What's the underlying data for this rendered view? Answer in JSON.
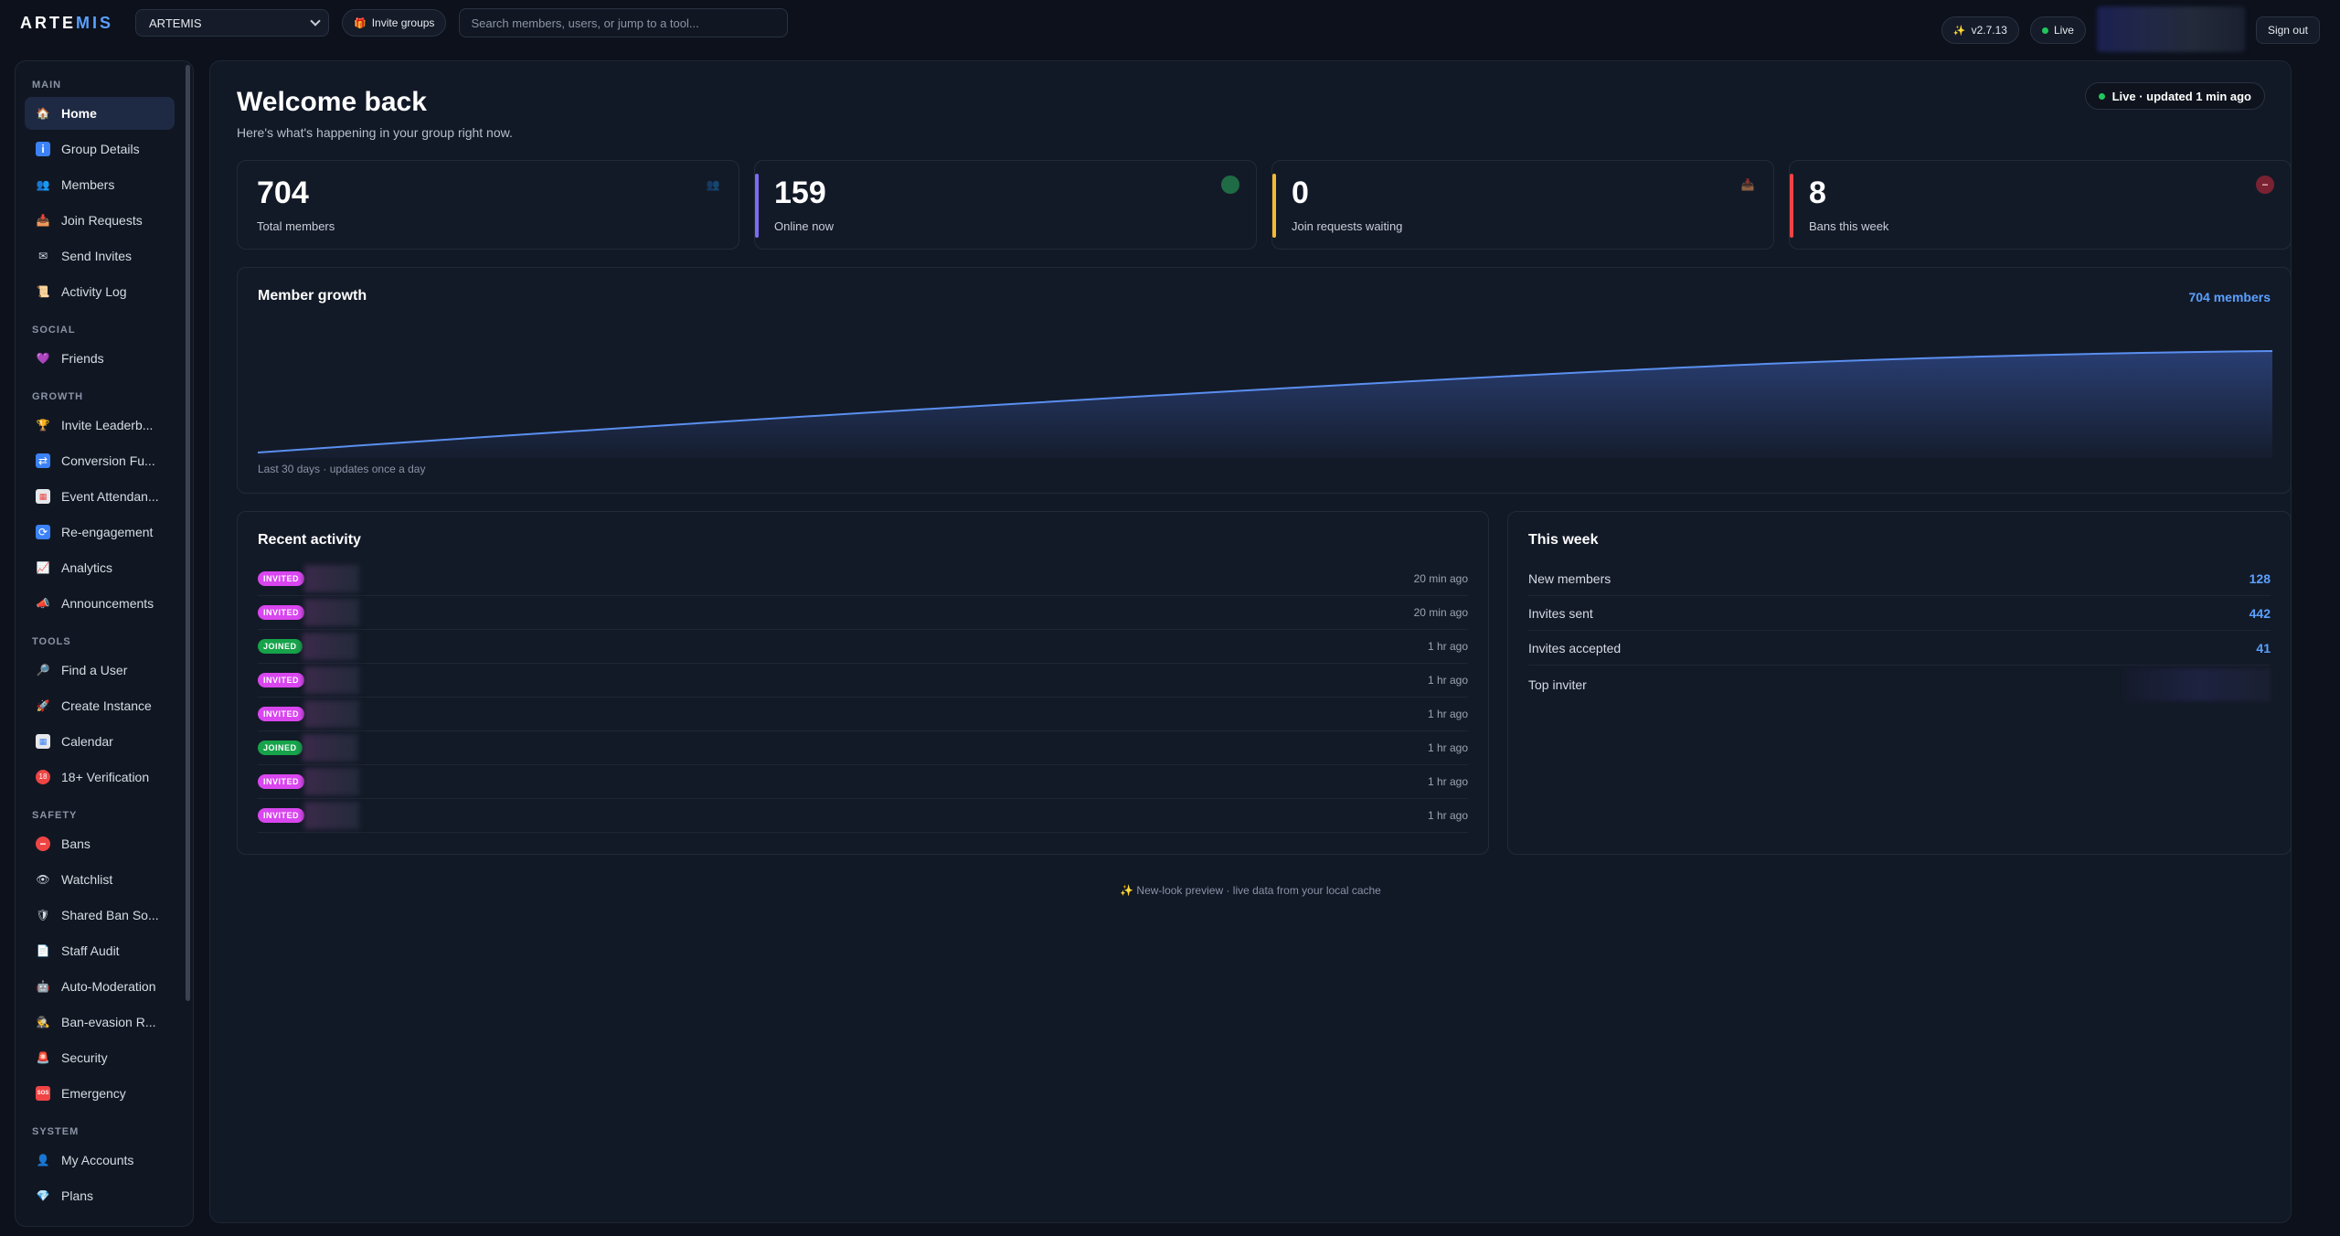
{
  "topbar": {
    "logo_main": "ARTE",
    "logo_accent": "MIS",
    "group_select_value": "ARTEMIS",
    "invite_groups_label": "Invite groups",
    "search_placeholder": "Search members, users, or jump to a tool...",
    "version_label": "v2.7.13",
    "live_label": "Live",
    "sign_out_label": "Sign out"
  },
  "sidebar": {
    "sections": {
      "main": "MAIN",
      "social": "SOCIAL",
      "growth": "GROWTH",
      "tools": "TOOLS",
      "safety": "SAFETY",
      "system": "SYSTEM"
    },
    "items": {
      "home": "Home",
      "group_details": "Group Details",
      "members": "Members",
      "join_requests": "Join Requests",
      "send_invites": "Send Invites",
      "activity_log": "Activity Log",
      "friends": "Friends",
      "invite_leaderboard": "Invite Leaderb...",
      "conversion_funnel": "Conversion Fu...",
      "event_attendance": "Event Attendan...",
      "reengagement": "Re-engagement",
      "analytics": "Analytics",
      "announcements": "Announcements",
      "find_user": "Find a User",
      "create_instance": "Create Instance",
      "calendar": "Calendar",
      "verification": "18+ Verification",
      "bans": "Bans",
      "watchlist": "Watchlist",
      "shared_ban": "Shared Ban So...",
      "staff_audit": "Staff Audit",
      "auto_moderation": "Auto-Moderation",
      "ban_evasion": "Ban-evasion R...",
      "security": "Security",
      "emergency": "Emergency",
      "my_accounts": "My Accounts",
      "plans": "Plans"
    }
  },
  "main": {
    "title": "Welcome back",
    "subtitle": "Here's what's happening in your group right now.",
    "live_status": "Live · updated 1 min ago",
    "stats": {
      "total_members": {
        "value": "704",
        "label": "Total members"
      },
      "online_now": {
        "value": "159",
        "label": "Online now"
      },
      "join_requests": {
        "value": "0",
        "label": "Join requests waiting"
      },
      "bans_week": {
        "value": "8",
        "label": "Bans this week"
      }
    },
    "growth": {
      "title": "Member growth",
      "count_label": "704 members",
      "caption": "Last 30 days · updates once a day"
    },
    "activity": {
      "title": "Recent activity",
      "rows": [
        {
          "badge": "INVITED",
          "time": "20 min ago"
        },
        {
          "badge": "INVITED",
          "time": "20 min ago"
        },
        {
          "badge": "JOINED",
          "time": "1 hr ago"
        },
        {
          "badge": "INVITED",
          "time": "1 hr ago"
        },
        {
          "badge": "INVITED",
          "time": "1 hr ago"
        },
        {
          "badge": "JOINED",
          "time": "1 hr ago"
        },
        {
          "badge": "INVITED",
          "time": "1 hr ago"
        },
        {
          "badge": "INVITED",
          "time": "1 hr ago"
        }
      ]
    },
    "week": {
      "title": "This week",
      "new_members": {
        "label": "New members",
        "value": "128"
      },
      "invites_sent": {
        "label": "Invites sent",
        "value": "442"
      },
      "invites_accepted": {
        "label": "Invites accepted",
        "value": "41"
      },
      "top_inviter": {
        "label": "Top inviter"
      }
    },
    "footer": "✨ New-look preview · live data from your local cache"
  },
  "colors": {
    "accent": "#5aa0ff",
    "online_bar": "#7c6cf0",
    "requests_bar": "#f5b931",
    "bans_bar": "#ef4444",
    "invited_badge": "#d946ef",
    "joined_badge": "#16a34a",
    "live_dot": "#22c55e"
  }
}
